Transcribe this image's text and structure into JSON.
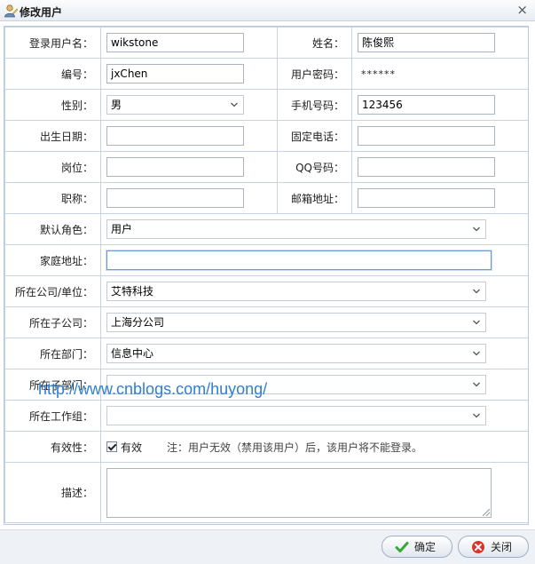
{
  "window": {
    "title": "修改用户",
    "close_glyph": "×"
  },
  "labels": {
    "login_name": "登录用户名：",
    "real_name": "姓名：",
    "code": "编号：",
    "password": "用户密码：",
    "gender": "性别：",
    "mobile": "手机号码：",
    "birthday": "出生日期：",
    "phone": "固定电话：",
    "post": "岗位：",
    "qq": "QQ号码：",
    "title": "职称：",
    "email": "邮箱地址：",
    "role": "默认角色：",
    "address": "家庭地址：",
    "company": "所在公司/单位：",
    "subcompany": "所在子公司：",
    "department": "所在部门：",
    "subdepartment": "所在子部门：",
    "workgroup": "所在工作组：",
    "validity": "有效性：",
    "description": "描述："
  },
  "values": {
    "login_name": "wikstone",
    "real_name": "陈俊熙",
    "code": "jxChen",
    "password": "******",
    "gender": "男",
    "mobile": "123456",
    "birthday": "",
    "phone": "",
    "post": "",
    "qq": "",
    "title": "",
    "email": "",
    "role": "用户",
    "address": "",
    "company": "艾特科技",
    "subcompany": "上海分公司",
    "department": "信息中心",
    "subdepartment": "",
    "workgroup": "",
    "valid_checked": true,
    "valid_label": "有效",
    "valid_note": "注：用户无效（禁用该用户）后，该用户将不能登录。",
    "description": ""
  },
  "watermark": "http://www.cnblogs.com/huyong/",
  "buttons": {
    "ok": "确定",
    "close": "关闭"
  },
  "colors": {
    "border": "#c6d4e2",
    "watermark": "#2f7fd0",
    "ok_icon": "#3aa63a",
    "close_icon": "#d9342b"
  }
}
